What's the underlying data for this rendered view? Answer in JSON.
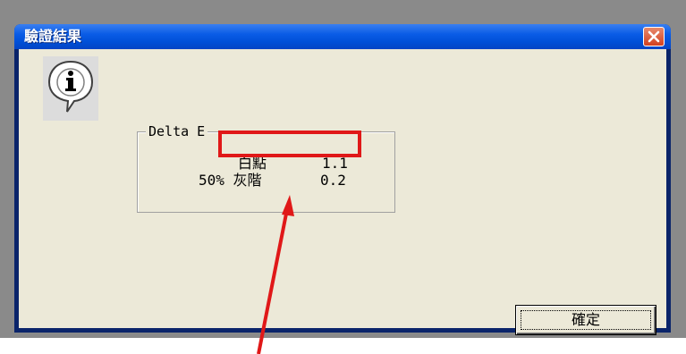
{
  "dialog": {
    "title": "驗證結果",
    "close_icon": "close-icon"
  },
  "content": {
    "icon": "info-icon",
    "group": {
      "legend": "Delta E",
      "rows": [
        {
          "label": "白點",
          "value": "1.1"
        },
        {
          "label": "50% 灰階",
          "value": "0.2"
        }
      ]
    },
    "ok_label": "確定"
  },
  "annotation": {
    "color": "#e01818"
  }
}
